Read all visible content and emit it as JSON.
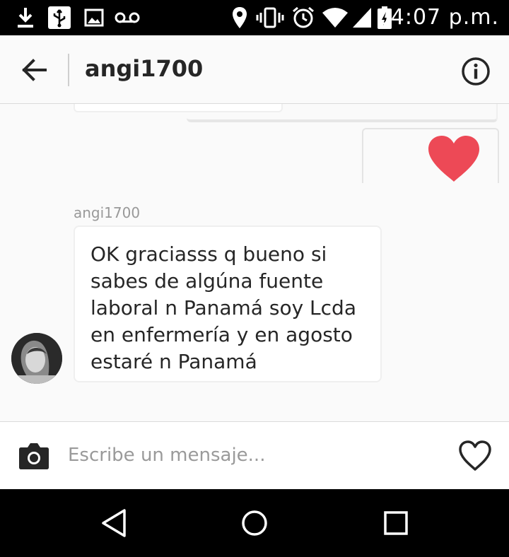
{
  "status_bar": {
    "time": "04:07 p.m.",
    "icons": [
      "download-icon",
      "usb-icon",
      "image-icon",
      "voicemail-icon",
      "location-icon",
      "vibrate-icon",
      "alarm-icon",
      "wifi-icon",
      "signal-icon",
      "battery-icon"
    ]
  },
  "header": {
    "title": "angi1700",
    "back_icon": "arrow-left-icon",
    "info_icon": "info-icon"
  },
  "conversation": {
    "sent": {
      "type": "heart",
      "color": "#ed4956"
    },
    "received": {
      "sender": "angi1700",
      "text": "OK graciasss q bueno si sabes de algúna fuente laboral n Panamá soy Lcda en enfermería y en agosto estaré n Panamá"
    }
  },
  "composer": {
    "placeholder": "Escribe un mensaje...",
    "value": "",
    "camera_icon": "camera-icon",
    "like_icon": "heart-outline-icon"
  },
  "nav_bar": {
    "buttons": [
      "back-triangle-icon",
      "home-circle-icon",
      "recents-square-icon"
    ]
  },
  "colors": {
    "heart": "#ed4956",
    "background": "#fafafa",
    "text": "#262626"
  }
}
